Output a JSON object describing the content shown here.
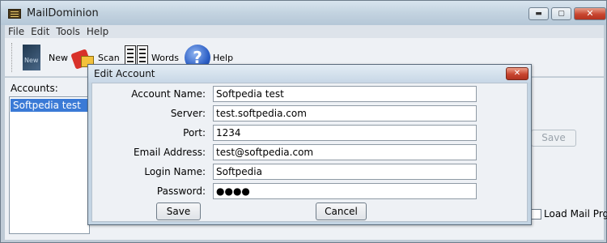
{
  "window": {
    "title": "MailDominion",
    "min_glyph": "▬",
    "max_glyph": "▢",
    "close_glyph": "✕"
  },
  "menu": [
    "File",
    "Edit",
    "Tools",
    "Help"
  ],
  "toolbar": {
    "new_label": "New",
    "scan_label": "Scan",
    "words_label": "Words",
    "help_label": "Help",
    "help_glyph": "?"
  },
  "main": {
    "accounts_label": "Accounts:",
    "accounts": [
      "Softpedia test"
    ],
    "save_label": "Save",
    "load_mail_label": "Load Mail Prg"
  },
  "dialog": {
    "title": "Edit Account",
    "close_glyph": "✕",
    "fields": {
      "account_name": {
        "label": "Account Name:",
        "value": "Softpedia test"
      },
      "server": {
        "label": "Server:",
        "value": "test.softpedia.com"
      },
      "port": {
        "label": "Port:",
        "value": "1234"
      },
      "email": {
        "label": "Email Address:",
        "value": "test@softpedia.com"
      },
      "login": {
        "label": "Login Name:",
        "value": "Softpedia"
      },
      "password": {
        "label": "Password:",
        "value": "●●●●"
      }
    },
    "save_label": "Save",
    "cancel_label": "Cancel"
  }
}
